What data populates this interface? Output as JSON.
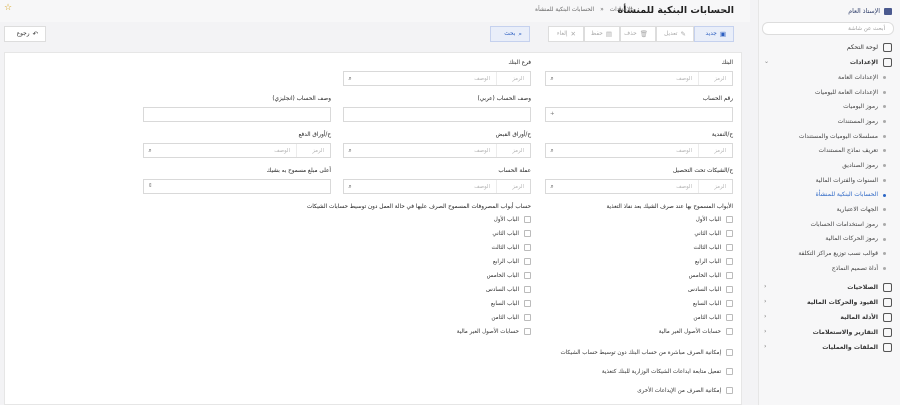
{
  "sidebar": {
    "title": "الإستاذ العام",
    "search_placeholder": "أبحث عن شاشة",
    "items": [
      {
        "label": "لوحة التحكم",
        "icon": "dashboard-icon"
      },
      {
        "label": "الإعدادات",
        "icon": "settings-icon"
      },
      {
        "label": "الإعدادات العامة"
      },
      {
        "label": "الإعدادات العامة لليوميات"
      },
      {
        "label": "رموز اليوميات"
      },
      {
        "label": "رموز المستندات"
      },
      {
        "label": "مسلسلات اليوميات والمستندات"
      },
      {
        "label": "تعريف نماذج المستندات"
      },
      {
        "label": "رموز الصناديق"
      },
      {
        "label": "السنوات والفترات المالية"
      },
      {
        "label": "الحسابات البنكية للمنشأة"
      },
      {
        "label": "الجهات الاعتبارية"
      },
      {
        "label": "رموز استخدامات الحسابات"
      },
      {
        "label": "رموز الحركات المالية"
      },
      {
        "label": "قوالب نسب توزيع مراكز التكلفة"
      },
      {
        "label": "أداة تصميم النماذج"
      },
      {
        "label": "الصلاحيات",
        "icon": "key-icon"
      },
      {
        "label": "القيود والحركات المالية",
        "icon": "ledger-icon"
      },
      {
        "label": "الأدلة المالية",
        "icon": "book-icon"
      },
      {
        "label": "التقارير والاستعلامات",
        "icon": "report-icon"
      },
      {
        "label": "الملفات والعمليات",
        "icon": "folder-icon"
      }
    ]
  },
  "header": {
    "title": "الحسابات البنكية للمنشأة",
    "breadcrumb_root": "الإعدادات",
    "breadcrumb_sep": "«",
    "breadcrumb_current": "الحسابات البنكية للمنشأة"
  },
  "toolbar": {
    "new": "جديد",
    "edit": "تعديل",
    "delete": "حذف",
    "save": "حفظ",
    "cancel": "إلغاء",
    "search": "بحث",
    "back": "رجوع"
  },
  "form": {
    "code_placeholder": "الرمز",
    "desc_placeholder": "الوصف",
    "bank": "البنك",
    "bank_branch": "فرع البنك",
    "account_number": "رقم الحساب",
    "account_desc_ar": "وصف الحساب (عربي)",
    "account_desc_en": "وصف الحساب (انجليزي)",
    "cash_account": "ح/النقدية",
    "receipts_account": "ح/أوراق القبض",
    "payments_account": "ح/أوراق الدفع",
    "checks_account": "ح/الشيكات تحت التحصيل",
    "currency": "عملة الحساب",
    "max_amount": "أعلى مبلغ مسموح به بشيك",
    "account_number_mark": "+"
  },
  "section_right": {
    "title": "الأبواب المسموح بها عند صرف الشيك بعد نفاذ التغذية",
    "items": [
      "الباب الأول",
      "الباب الثاني",
      "الباب الثالث",
      "الباب الرابع",
      "الباب الخامس",
      "الباب السادس",
      "الباب السابع",
      "الباب الثامن",
      "حسابات الأصول الغير مالية"
    ]
  },
  "section_left": {
    "title": "حساب أبواب المصروفات المسموح الصرف عليها في حالة العمل دون توسيط حسابات الشيكات",
    "items": [
      "الباب الأول",
      "الباب الثاني",
      "الباب الثالث",
      "الباب الرابع",
      "الباب الخامس",
      "الباب السادس",
      "الباب السابع",
      "الباب الثامن",
      "حسابات الأصول الغير مالية"
    ]
  },
  "options": [
    "إمكانية الصرف مباشرة من حساب البنك دون توسيط حساب الشيكات",
    "تفعيل متابعة ايداعات الشيكات الوزارية للبنك كتغذية",
    "إمكانية الصرف من الإيداعات الأخرى"
  ]
}
